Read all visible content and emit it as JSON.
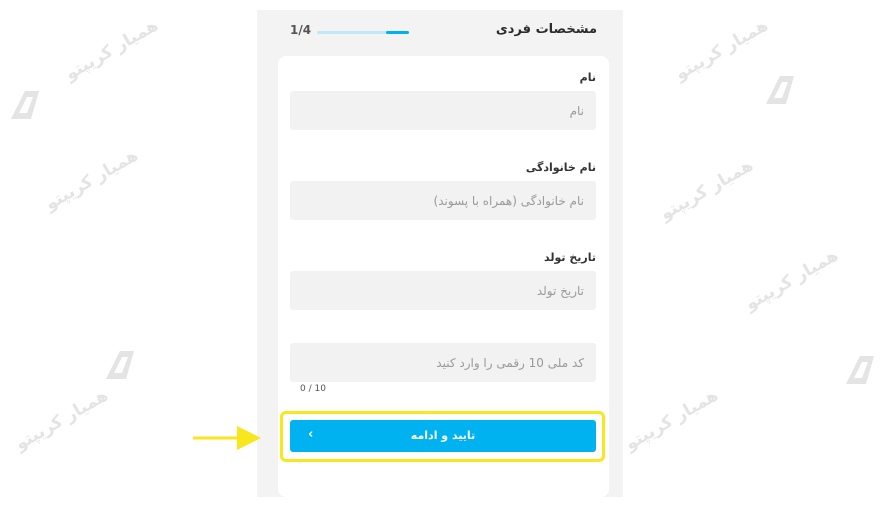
{
  "header": {
    "title": "مشخصات فردی",
    "step": "1/4",
    "progress": 0.25
  },
  "form": {
    "first_name": {
      "label": "نام",
      "placeholder": "نام"
    },
    "last_name": {
      "label": "نام خانوادگی",
      "placeholder": "نام خانوادگی (همراه با پسوند)"
    },
    "birth_date": {
      "label": "تاریخ تولد",
      "placeholder": "تاریخ تولد"
    },
    "national_code": {
      "placeholder": "کد ملی 10 رقمی را وارد کنید",
      "counter": "0 / 10"
    }
  },
  "submit": {
    "label": "تایید و ادامه",
    "icon": "chevron-left-icon"
  },
  "watermark": {
    "text": "همیار کریپتو",
    "url": "www.hamyarcrypto.com"
  },
  "colors": {
    "accent": "#00b2ef",
    "progress_track": "#bfe9f5",
    "highlight": "#f8e71c",
    "panel_bg": "#f3f3f4",
    "field_bg": "#f2f2f3"
  }
}
